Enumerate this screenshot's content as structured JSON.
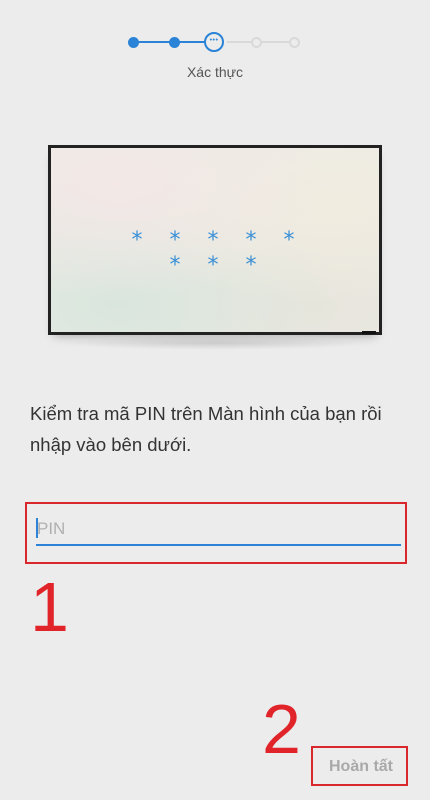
{
  "stepper": {
    "total_steps": 5,
    "current_step": 3,
    "current_step_label": "Xác thực",
    "active_color": "#2a83d6",
    "inactive_color": "#d9d9d9"
  },
  "tv": {
    "pin_mask": "* * * * * * * *"
  },
  "instruction": {
    "text": "Kiểm tra mã PIN trên Màn hình của bạn rồi nhập vào bên dưới."
  },
  "pin_field": {
    "value": "",
    "placeholder": "PIN"
  },
  "annotations": {
    "marker_1": "1",
    "marker_2": "2",
    "color": "#e0242a"
  },
  "footer": {
    "done_label": "Hoàn tất"
  }
}
